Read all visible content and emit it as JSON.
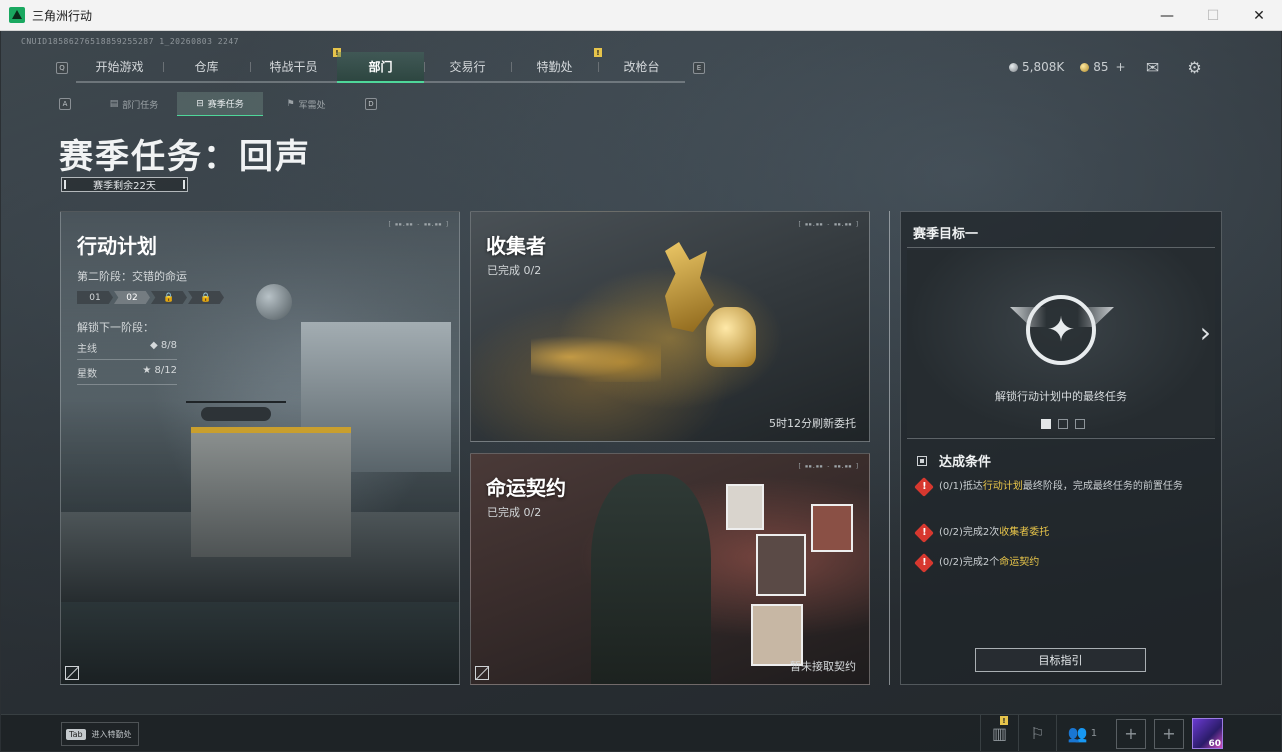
{
  "window": {
    "title": "三角洲行动",
    "controls": [
      "—",
      "☐",
      "✕"
    ]
  },
  "uid": "CNUID18586276518859255287 1_20260803 2247",
  "topnav": {
    "key_left": "Q",
    "key_right": "E",
    "tabs": [
      {
        "label": "开始游戏",
        "active": false,
        "badge": ""
      },
      {
        "label": "仓库",
        "active": false,
        "badge": ""
      },
      {
        "label": "特战干员",
        "active": false,
        "badge": "!"
      },
      {
        "label": "部门",
        "active": true,
        "badge": ""
      },
      {
        "label": "交易行",
        "active": false,
        "badge": ""
      },
      {
        "label": "特勤处",
        "active": false,
        "badge": "!"
      },
      {
        "label": "改枪台",
        "active": false,
        "badge": ""
      }
    ]
  },
  "currency": {
    "silver": "5,808K",
    "gold": "85",
    "gold_add": "+",
    "mail_icon": "mail-icon",
    "settings_icon": "gear-icon"
  },
  "subnav": {
    "key_left": "A",
    "key_right": "D",
    "tabs": [
      {
        "label": "部门任务",
        "active": false
      },
      {
        "label": "赛季任务",
        "active": true
      },
      {
        "label": "军需处",
        "active": false
      }
    ]
  },
  "page": {
    "title": "赛季任务：回声",
    "remaining": "赛季剩余22天"
  },
  "plan_card": {
    "title": "行动计划",
    "stage": "第二阶段：交错的命运",
    "stages": [
      "01",
      "02",
      "🔒",
      "🔒"
    ],
    "unlock_label": "解锁下一阶段：",
    "main_label": "主线",
    "main_value": "◆ 8/8",
    "star_label": "星数",
    "star_value": "★ 8/12"
  },
  "collector_card": {
    "title": "收集者",
    "progress": "已完成 0/2",
    "footer": "5时12分刷新委托"
  },
  "fate_card": {
    "title": "命运契约",
    "progress": "已完成 0/2",
    "footer": "暂未接取契约"
  },
  "goal_panel": {
    "title": "赛季目标一",
    "caption": "解锁行动计划中的最终任务",
    "conditions_title": "达成条件",
    "conditions": [
      {
        "prefix": "(0/1)抵达",
        "highlight": "行动计划",
        "suffix": "最终阶段，完成最终任务的前置任务"
      },
      {
        "prefix": "(0/2)完成2次",
        "highlight": "收集者委托",
        "suffix": ""
      },
      {
        "prefix": "(0/2)完成2个",
        "highlight": "命运契约",
        "suffix": ""
      }
    ],
    "guide_button": "目标指引"
  },
  "bottom": {
    "tab_key": "Tab",
    "tab_hint": "进入特勤处",
    "squad_count": "1",
    "avatar_level": "60"
  },
  "colors": {
    "accent": "#4fd79a",
    "highlight": "#e9c64a",
    "warning": "#d7382f"
  }
}
